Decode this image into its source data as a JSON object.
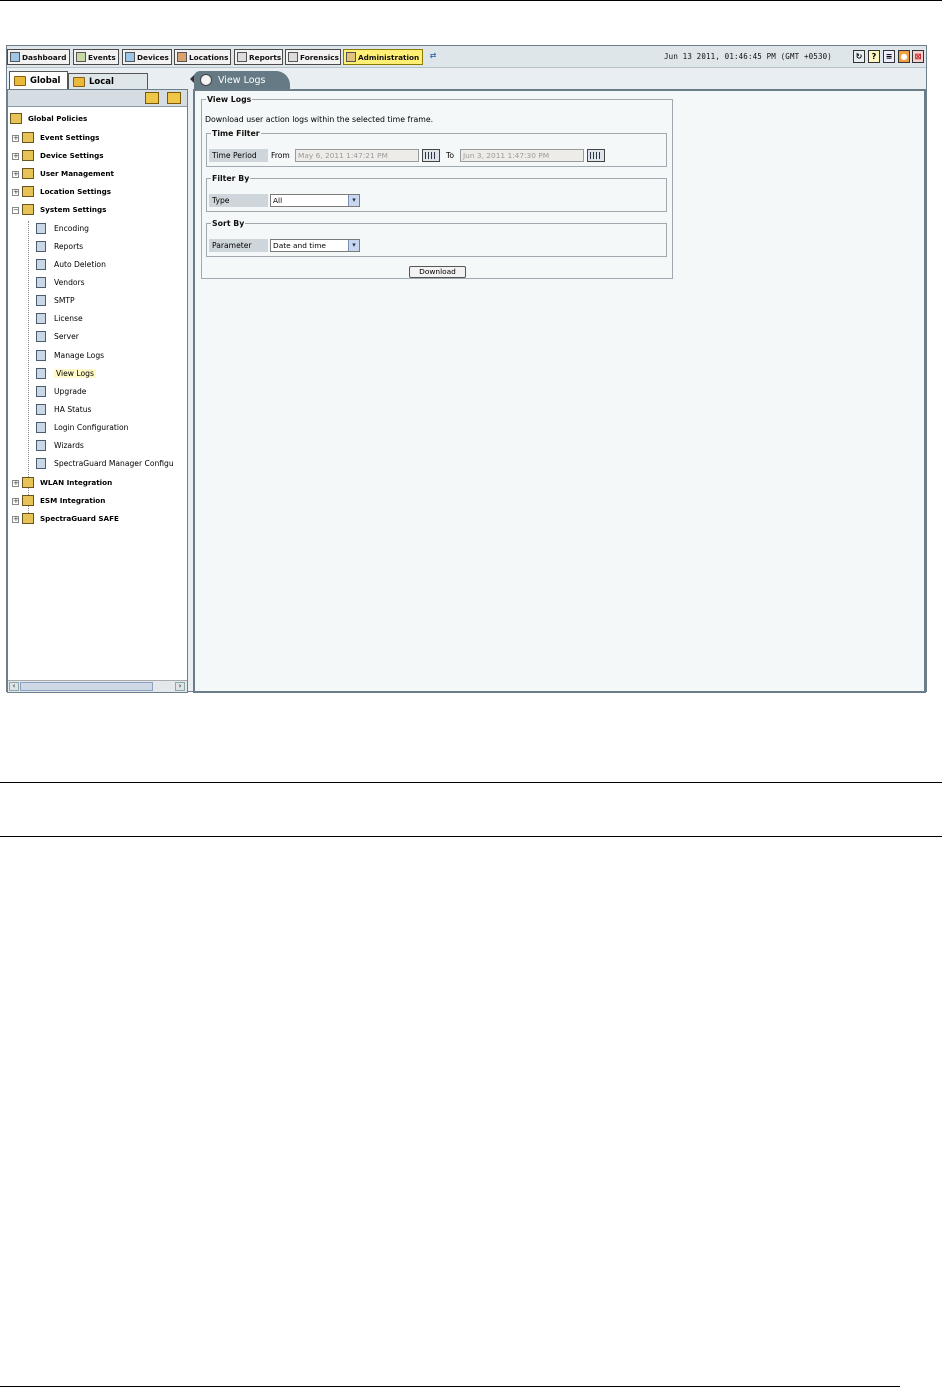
{
  "toolbar": {
    "buttons": [
      "Dashboard",
      "Events",
      "Devices",
      "Locations",
      "Reports",
      "Forensics",
      "Administration"
    ],
    "active": "Administration",
    "datetime": "Jun 13 2011, 01:46:45 PM (GMT +0530)"
  },
  "left_panel": {
    "tabs": [
      "Global",
      "Local"
    ],
    "tree": {
      "root": "Global Policies",
      "groups": [
        "Event Settings",
        "Device Settings",
        "User Management",
        "Location Settings",
        "System Settings"
      ],
      "system_children": [
        "Encoding",
        "Reports",
        "Auto Deletion",
        "Vendors",
        "SMTP",
        "License",
        "Server",
        "Manage Logs",
        "View Logs",
        "Upgrade",
        "HA Status",
        "Login Configuration",
        "Wizards",
        "SpectraGuard Manager Configu"
      ],
      "more_groups": [
        "WLAN Integration",
        "ESM Integration",
        "SpectraGuard SAFE"
      ],
      "selected": "View Logs"
    }
  },
  "view_logs": {
    "tab_title": "View Logs",
    "section_title": "View Logs",
    "description": "Download user action logs within the selected time frame.",
    "time_filter": {
      "legend": "Time Filter",
      "label": "Time Period",
      "from_label": "From",
      "from_value": "May 6, 2011 1:47:21 PM",
      "to_label": "To",
      "to_value": "Jun 3, 2011 1:47:30 PM"
    },
    "filter_by": {
      "legend": "Filter By",
      "label": "Type",
      "value": "All"
    },
    "sort_by": {
      "legend": "Sort By",
      "label": "Parameter",
      "value": "Date and time"
    },
    "download_label": "Download"
  }
}
